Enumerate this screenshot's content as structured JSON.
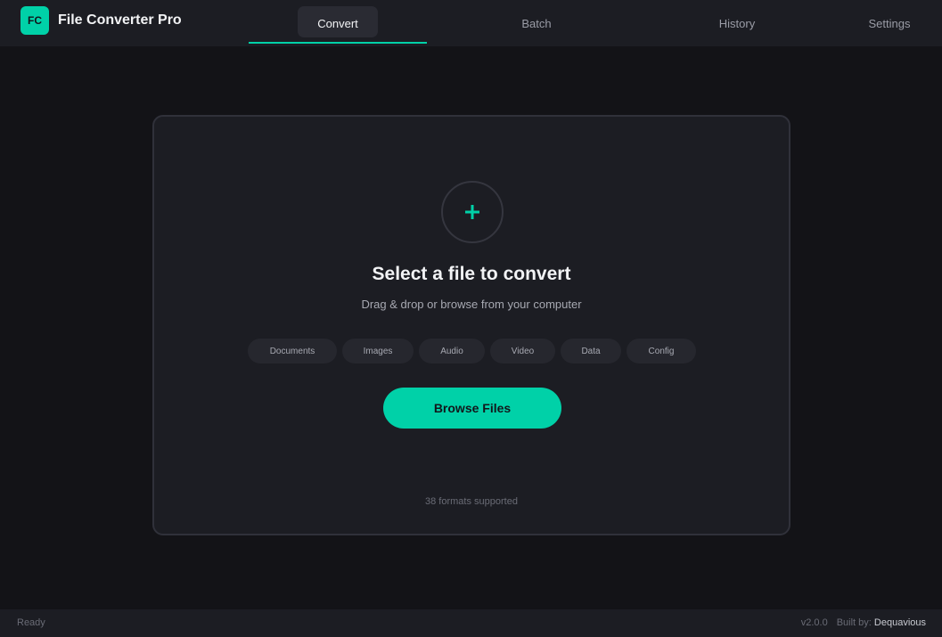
{
  "app": {
    "logo_text": "FC",
    "title": "File Converter Pro",
    "accent_color": "#00d1a8"
  },
  "tabs": [
    {
      "label": "Convert",
      "active": true
    },
    {
      "label": "Batch",
      "active": false
    },
    {
      "label": "History",
      "active": false
    },
    {
      "label": "Settings",
      "active": false
    }
  ],
  "dropzone": {
    "icon": "plus-icon",
    "title": "Select a file to convert",
    "subtitle": "Drag & drop or browse from your computer",
    "categories": [
      "Documents",
      "Images",
      "Audio",
      "Video",
      "Data",
      "Config"
    ],
    "browse_label": "Browse Files",
    "formats_text": "38 formats supported"
  },
  "status": {
    "text": "Ready",
    "version": "v2.0.0",
    "built_by_label": "Built by:",
    "author": "Dequavious"
  }
}
